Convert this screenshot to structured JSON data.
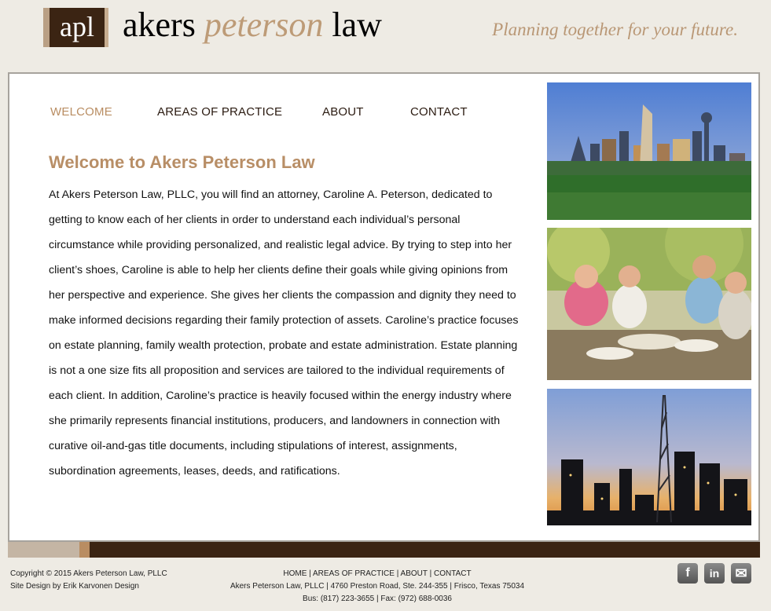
{
  "header": {
    "logo_text": "apl",
    "brand_first": "akers",
    "brand_mid": "peterson",
    "brand_last": "law",
    "tagline": "Planning together for your future."
  },
  "nav": {
    "items": [
      "WELCOME",
      "AREAS OF PRACTICE",
      "ABOUT",
      "CONTACT"
    ],
    "active_index": 0
  },
  "main": {
    "heading": "Welcome to Akers Peterson Law",
    "paragraph": "At Akers Peterson Law, PLLC, you will find an attorney, Caroline A. Peterson, dedicated to getting to know each of her clients in order to understand each individual’s personal circumstance while providing personalized, and realistic legal advice. By trying to step into her client’s shoes, Caroline is able to help her clients define their goals while giving opinions from her perspective and experience. She gives her clients the compassion and dignity they need to make informed decisions regarding their family protection of assets. Caroline’s practice focuses on estate planning, family wealth protection, probate and estate administration. Estate planning is not a one size fits all proposition and services are tailored to the individual requirements of each client. In addition, Caroline’s practice is heavily focused within the energy industry where she primarily represents financial institutions, producers, and landowners in connection with curative oil-and-gas title documents, including stipulations of interest, assignments, subordination agreements, leases, deeds, and ratifications."
  },
  "footer": {
    "copyright": "Copyright © 2015 Akers Peterson Law, PLLC",
    "design_credit": "Site Design by Erik Karvonen Design",
    "links": [
      "HOME",
      "AREAS OF PRACTICE",
      "ABOUT",
      "CONTACT"
    ],
    "address": "Akers Peterson Law, PLLC | 4760 Preston Road, Ste. 244-355 | Frisco, Texas 75034",
    "phones": "Bus: (817) 223-3655 | Fax: (972) 688-0036"
  },
  "social": [
    {
      "icon": "facebook-icon",
      "glyph": "f"
    },
    {
      "icon": "linkedin-icon",
      "glyph": "in"
    },
    {
      "icon": "mail-icon",
      "glyph": "✉"
    }
  ],
  "colors": {
    "accent": "#b88e66",
    "dark_brown": "#3b2413",
    "page_bg": "#eeebe4"
  }
}
